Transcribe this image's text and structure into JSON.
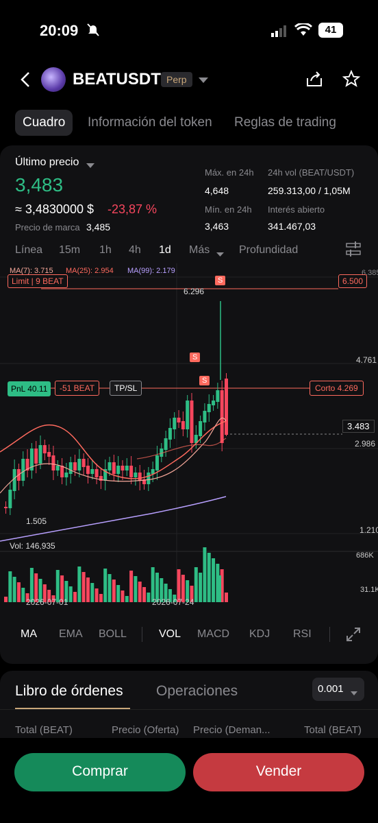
{
  "status_bar": {
    "time": "20:09",
    "battery": "41"
  },
  "header": {
    "symbol": "BEATUSDT",
    "badge": "Perp"
  },
  "tabs": [
    "Cuadro",
    "Información del token",
    "Reglas de trading"
  ],
  "ticker": {
    "last_price_label": "Último precio",
    "last_price": "3,483",
    "approx": "≈ 3,4830000 $",
    "change": "-23,87 %",
    "mark_label": "Precio de marca",
    "mark_price": "3,485",
    "high_label": "Máx. en 24h",
    "high": "4,648",
    "vol_label": "24h vol (BEAT/USDT)",
    "vol": "259.313,00 / 1,05M",
    "low_label": "Mín. en 24h",
    "low": "3,463",
    "oi_label": "Interés abierto",
    "oi": "341.467,03"
  },
  "timeframes": [
    "Línea",
    "15m",
    "1h",
    "4h",
    "1d",
    "Más",
    "Profundidad"
  ],
  "chart": {
    "ma7": "MA(7): 3.715",
    "ma25": "MA(25): 2.954",
    "ma99": "MA(99): 2.179",
    "limit_label": "Limit",
    "limit_qty": "9 BEAT",
    "limit_price": "6.500",
    "high_mark": "6.296",
    "low_mark": "1.505",
    "pnl": "PnL 40.11",
    "pos_qty": "-51  BEAT",
    "tpsl": "TP/SL",
    "short": "Corto 4.269",
    "axis": [
      "4.761",
      "3.483",
      "2.986",
      "1.210"
    ],
    "top_axis": "6.385",
    "sell_marker": "S",
    "vol_label": "Vol: 146,935",
    "vol_axis": [
      "686K",
      "31.1K"
    ],
    "dates": [
      "2026-07-01",
      "2026-07-24"
    ]
  },
  "indicators": [
    "MA",
    "EMA",
    "BOLL",
    "VOL",
    "MACD",
    "KDJ",
    "RSI"
  ],
  "orderbook": {
    "tab1": "Libro de órdenes",
    "tab2": "Operaciones",
    "precision": "0.001",
    "cols": [
      "Total (BEAT)",
      "Precio (Oferta)",
      "Precio (Deman...",
      "Total (BEAT)"
    ]
  },
  "actions": {
    "buy": "Comprar",
    "sell": "Vender"
  },
  "colors": {
    "green": "#2ebd85",
    "red": "#f6465d",
    "accent": "#ff6a5e"
  }
}
